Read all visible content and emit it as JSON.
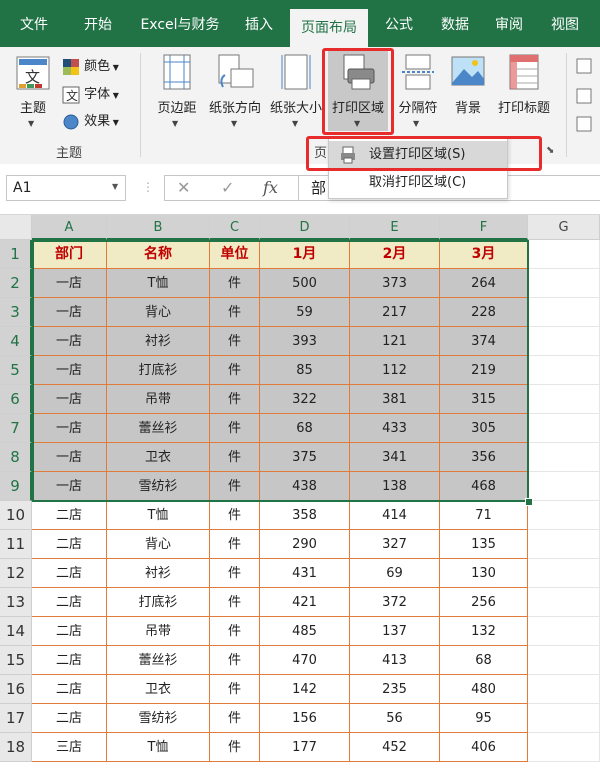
{
  "tabs": [
    {
      "label": "文件"
    },
    {
      "label": "开始"
    },
    {
      "label": "Excel与财务"
    },
    {
      "label": "插入"
    },
    {
      "label": "页面布局"
    },
    {
      "label": "公式"
    },
    {
      "label": "数据"
    },
    {
      "label": "审阅"
    },
    {
      "label": "视图"
    }
  ],
  "ribbon": {
    "theme_label": "主题",
    "colors_label": "颜色",
    "fonts_label": "字体",
    "effects_label": "效果",
    "group_theme": "主题",
    "margins_label": "页边距",
    "orientation_label": "纸张方向",
    "size_label": "纸张大小",
    "print_area_label": "打印区域",
    "breaks_label": "分隔符",
    "background_label": "背景",
    "print_titles_label": "打印标题",
    "group_page_fragment": "页"
  },
  "menu": {
    "set_print_area": "设置打印区域(S)",
    "clear_print_area": "取消打印区域(C)"
  },
  "formula_bar": {
    "name_box": "A1",
    "content": "部",
    "fx": "fx"
  },
  "columns": [
    "A",
    "B",
    "C",
    "D",
    "E",
    "F",
    "G"
  ],
  "table": {
    "header": [
      "部门",
      "名称",
      "单位",
      "1月",
      "2月",
      "3月"
    ],
    "rows": [
      [
        "一店",
        "T恤",
        "件",
        "500",
        "373",
        "264"
      ],
      [
        "一店",
        "背心",
        "件",
        "59",
        "217",
        "228"
      ],
      [
        "一店",
        "衬衫",
        "件",
        "393",
        "121",
        "374"
      ],
      [
        "一店",
        "打底衫",
        "件",
        "85",
        "112",
        "219"
      ],
      [
        "一店",
        "吊带",
        "件",
        "322",
        "381",
        "315"
      ],
      [
        "一店",
        "蕾丝衫",
        "件",
        "68",
        "433",
        "305"
      ],
      [
        "一店",
        "卫衣",
        "件",
        "375",
        "341",
        "356"
      ],
      [
        "一店",
        "雪纺衫",
        "件",
        "438",
        "138",
        "468"
      ],
      [
        "二店",
        "T恤",
        "件",
        "358",
        "414",
        "71"
      ],
      [
        "二店",
        "背心",
        "件",
        "290",
        "327",
        "135"
      ],
      [
        "二店",
        "衬衫",
        "件",
        "431",
        "69",
        "130"
      ],
      [
        "二店",
        "打底衫",
        "件",
        "421",
        "372",
        "256"
      ],
      [
        "二店",
        "吊带",
        "件",
        "485",
        "137",
        "132"
      ],
      [
        "二店",
        "蕾丝衫",
        "件",
        "470",
        "413",
        "68"
      ],
      [
        "二店",
        "卫衣",
        "件",
        "142",
        "235",
        "480"
      ],
      [
        "二店",
        "雪纺衫",
        "件",
        "156",
        "56",
        "95"
      ],
      [
        "三店",
        "T恤",
        "件",
        "177",
        "452",
        "406"
      ]
    ]
  },
  "colors": {
    "accent": "#217346",
    "highlight": "#e82b2b",
    "header_fill": "#fff2cc",
    "header_text": "#c00000",
    "border": "#e07b39",
    "selection_fill": "#c6c6c6"
  }
}
